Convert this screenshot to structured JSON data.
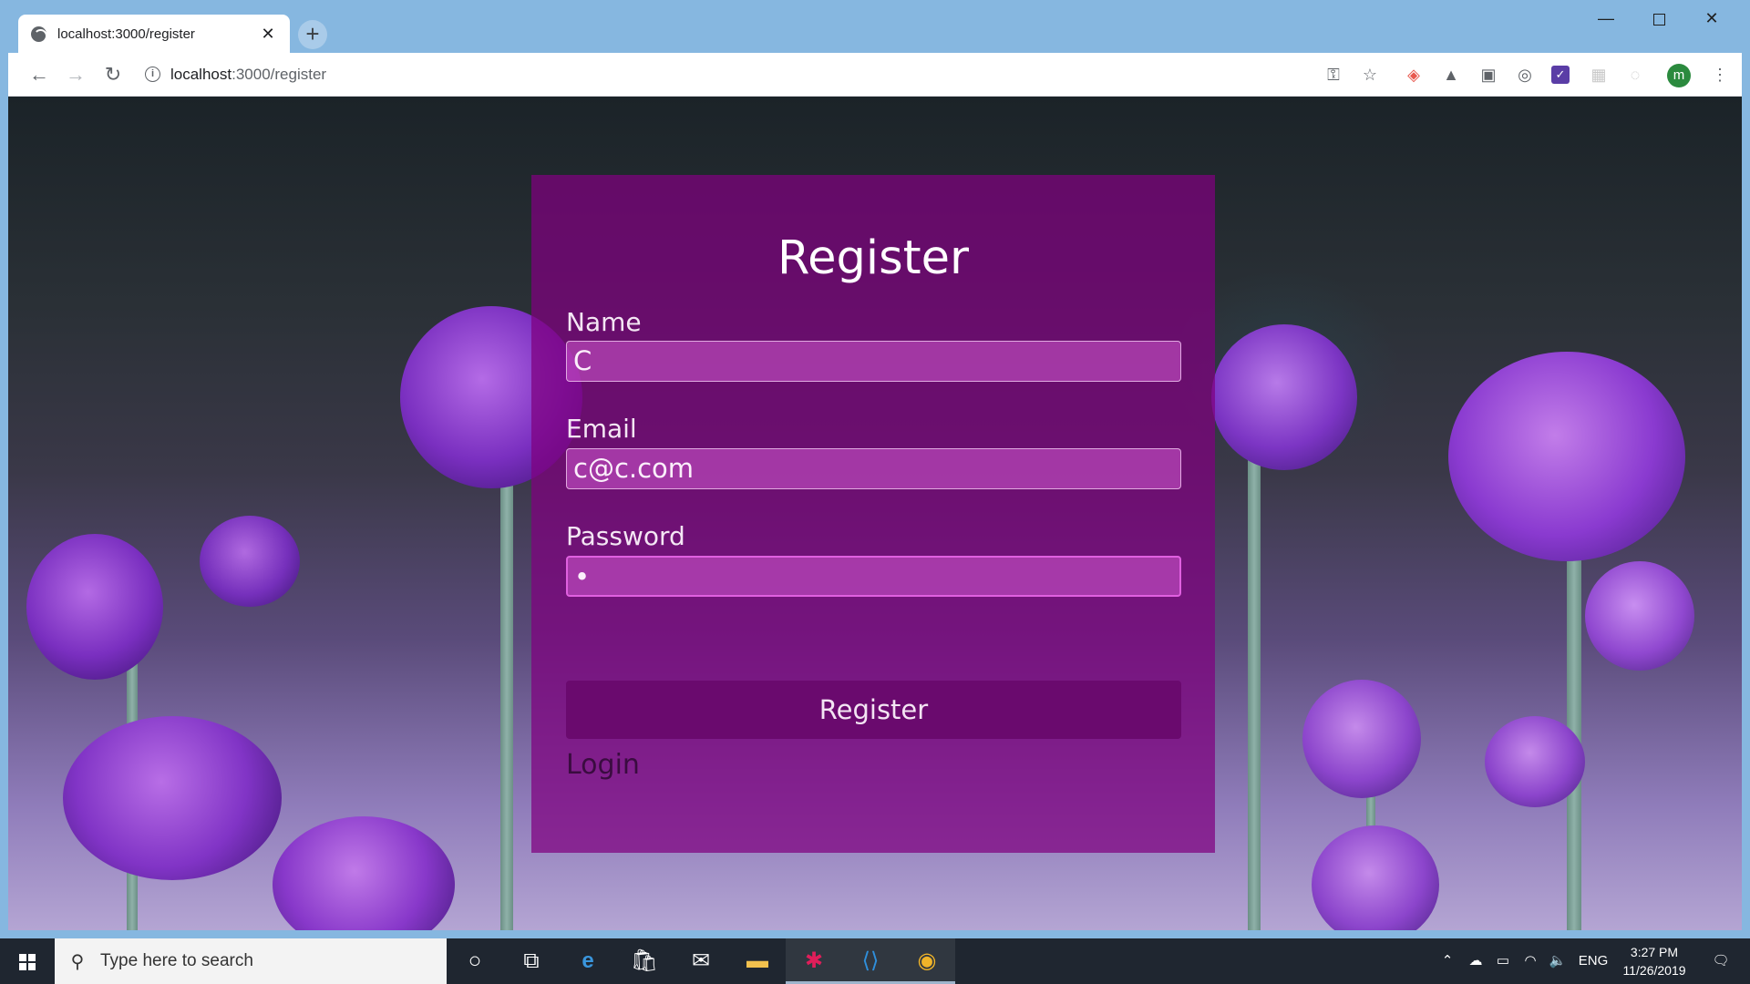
{
  "browser": {
    "tab_title": "localhost:3000/register",
    "tab_close": "✕",
    "new_tab": "+",
    "url_host": "localhost",
    "url_path": ":3000/register",
    "avatar_letter": "m"
  },
  "form": {
    "title": "Register",
    "name_label": "Name",
    "name_value": "C",
    "email_label": "Email",
    "email_value": "c@c.com",
    "password_label": "Password",
    "password_value": "•",
    "submit_label": "Register",
    "login_link": "Login"
  },
  "taskbar": {
    "search_placeholder": "Type here to search",
    "language": "ENG",
    "time": "3:27 PM",
    "date": "11/26/2019"
  },
  "icons": {
    "tab": "globe-icon",
    "nav": [
      "back-arrow-icon",
      "forward-arrow-icon",
      "reload-icon",
      "info-icon"
    ],
    "toolbar": [
      "key-icon",
      "star-icon",
      "extension-icons",
      "menu-dots-icon"
    ],
    "taskbar": [
      "windows-start-icon",
      "search-icon",
      "cortana-icon",
      "task-view-icon",
      "edge-icon",
      "store-icon",
      "mail-icon",
      "file-explorer-icon",
      "slack-icon",
      "vscode-icon",
      "chrome-icon"
    ]
  },
  "colors": {
    "card_bg": "#800080",
    "button_bg": "#6a0a6e",
    "titlebar": "#86b7e0",
    "taskbar": "#1f2630"
  }
}
